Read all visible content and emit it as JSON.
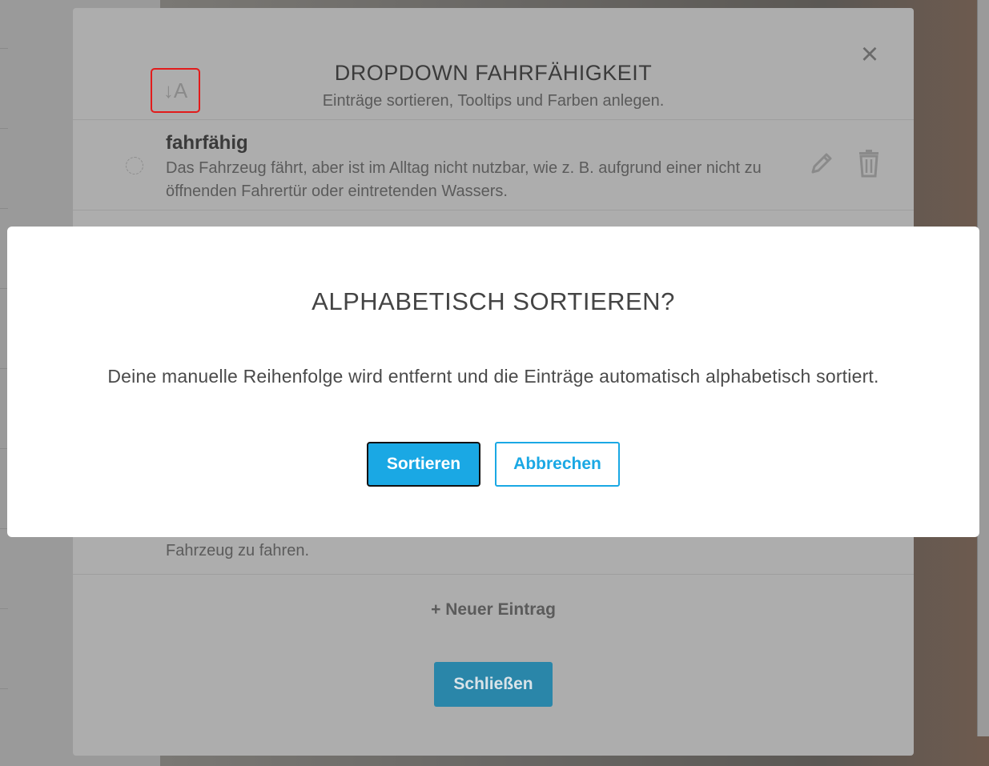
{
  "parent_modal": {
    "title": "DROPDOWN FAHRFÄHIGKEIT",
    "subtitle": "Einträge sortieren, Tooltips und Farben anlegen.",
    "close_icon": "close-icon",
    "sort_icon": "sort-alphabetical-icon",
    "sort_icon_glyph": "↓A",
    "entries": [
      {
        "name": "fahrfähig",
        "description": "Das Fahrzeug fährt, aber ist im Alltag nicht nutzbar, wie z. B. aufgrund einer nicht zu öffnenden Fahrertür oder eintretenden Wassers."
      }
    ],
    "partial_entry_text": "Fahrzeug zu fahren.",
    "new_entry_label": "+ Neuer Eintrag",
    "close_button_label": "Schließen",
    "colors": {
      "close_button": "#2a86a9",
      "highlight_border": "#e21b1b"
    }
  },
  "dialog": {
    "title": "ALPHABETISCH SORTIEREN?",
    "text": "Deine manuelle Reihenfolge wird entfernt und die Einträge automatisch alphabetisch sortiert.",
    "confirm_label": "Sortieren",
    "cancel_label": "Abbrechen",
    "colors": {
      "accent": "#1aa8e4"
    }
  }
}
